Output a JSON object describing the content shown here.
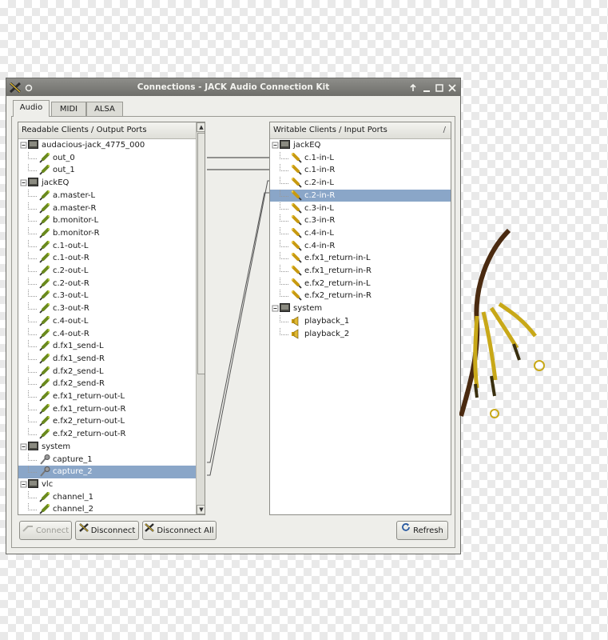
{
  "window": {
    "title": "Connections - JACK Audio Connection Kit",
    "titlebar_icons": [
      "close-icon",
      "minimize-icon",
      "maximize-icon",
      "close-x-icon"
    ]
  },
  "tabs": [
    {
      "label": "Audio",
      "active": true
    },
    {
      "label": "MIDI",
      "active": false
    },
    {
      "label": "ALSA",
      "active": false
    }
  ],
  "readable": {
    "header": "Readable Clients / Output Ports",
    "sort_glyph": "/",
    "rows": [
      {
        "label": "audacious-jack_4775_000",
        "type": "client",
        "selected": false
      },
      {
        "label": "out_0",
        "type": "port",
        "selected": false
      },
      {
        "label": "out_1",
        "type": "port",
        "selected": false
      },
      {
        "label": "jackEQ",
        "type": "client",
        "selected": false
      },
      {
        "label": "a.master-L",
        "type": "port",
        "selected": false
      },
      {
        "label": "a.master-R",
        "type": "port",
        "selected": false
      },
      {
        "label": "b.monitor-L",
        "type": "port",
        "selected": false
      },
      {
        "label": "b.monitor-R",
        "type": "port",
        "selected": false
      },
      {
        "label": "c.1-out-L",
        "type": "port",
        "selected": false
      },
      {
        "label": "c.1-out-R",
        "type": "port",
        "selected": false
      },
      {
        "label": "c.2-out-L",
        "type": "port",
        "selected": false
      },
      {
        "label": "c.2-out-R",
        "type": "port",
        "selected": false
      },
      {
        "label": "c.3-out-L",
        "type": "port",
        "selected": false
      },
      {
        "label": "c.3-out-R",
        "type": "port",
        "selected": false
      },
      {
        "label": "c.4-out-L",
        "type": "port",
        "selected": false
      },
      {
        "label": "c.4-out-R",
        "type": "port",
        "selected": false
      },
      {
        "label": "d.fx1_send-L",
        "type": "port",
        "selected": false
      },
      {
        "label": "d.fx1_send-R",
        "type": "port",
        "selected": false
      },
      {
        "label": "d.fx2_send-L",
        "type": "port",
        "selected": false
      },
      {
        "label": "d.fx2_send-R",
        "type": "port",
        "selected": false
      },
      {
        "label": "e.fx1_return-out-L",
        "type": "port",
        "selected": false
      },
      {
        "label": "e.fx1_return-out-R",
        "type": "port",
        "selected": false
      },
      {
        "label": "e.fx2_return-out-L",
        "type": "port",
        "selected": false
      },
      {
        "label": "e.fx2_return-out-R",
        "type": "port",
        "selected": false
      },
      {
        "label": "system",
        "type": "client",
        "selected": false
      },
      {
        "label": "capture_1",
        "type": "mic",
        "selected": false
      },
      {
        "label": "capture_2",
        "type": "mic",
        "selected": true
      },
      {
        "label": "vlc",
        "type": "client",
        "selected": false
      },
      {
        "label": "channel_1",
        "type": "port",
        "selected": false
      },
      {
        "label": "channel_2",
        "type": "port",
        "selected": false
      }
    ]
  },
  "writable": {
    "header": "Writable Clients / Input Ports",
    "sort_glyph": "/",
    "rows": [
      {
        "label": "jackEQ",
        "type": "client",
        "selected": false
      },
      {
        "label": "c.1-in-L",
        "type": "port",
        "selected": false
      },
      {
        "label": "c.1-in-R",
        "type": "port",
        "selected": false
      },
      {
        "label": "c.2-in-L",
        "type": "port",
        "selected": false
      },
      {
        "label": "c.2-in-R",
        "type": "port",
        "selected": true
      },
      {
        "label": "c.3-in-L",
        "type": "port",
        "selected": false
      },
      {
        "label": "c.3-in-R",
        "type": "port",
        "selected": false
      },
      {
        "label": "c.4-in-L",
        "type": "port",
        "selected": false
      },
      {
        "label": "c.4-in-R",
        "type": "port",
        "selected": false
      },
      {
        "label": "e.fx1_return-in-L",
        "type": "port",
        "selected": false
      },
      {
        "label": "e.fx1_return-in-R",
        "type": "port",
        "selected": false
      },
      {
        "label": "e.fx2_return-in-L",
        "type": "port",
        "selected": false
      },
      {
        "label": "e.fx2_return-in-R",
        "type": "port",
        "selected": false
      },
      {
        "label": "system",
        "type": "client",
        "selected": false
      },
      {
        "label": "playback_1",
        "type": "speaker",
        "selected": false
      },
      {
        "label": "playback_2",
        "type": "speaker",
        "selected": false
      }
    ]
  },
  "buttons": {
    "connect": "Connect",
    "disconnect": "Disconnect",
    "disconnect_all": "Disconnect All",
    "refresh": "Refresh"
  },
  "colors": {
    "selection": "#8aa6c8",
    "port_icon": "#6a8a1e",
    "input_port_icon": "#c89a10"
  }
}
